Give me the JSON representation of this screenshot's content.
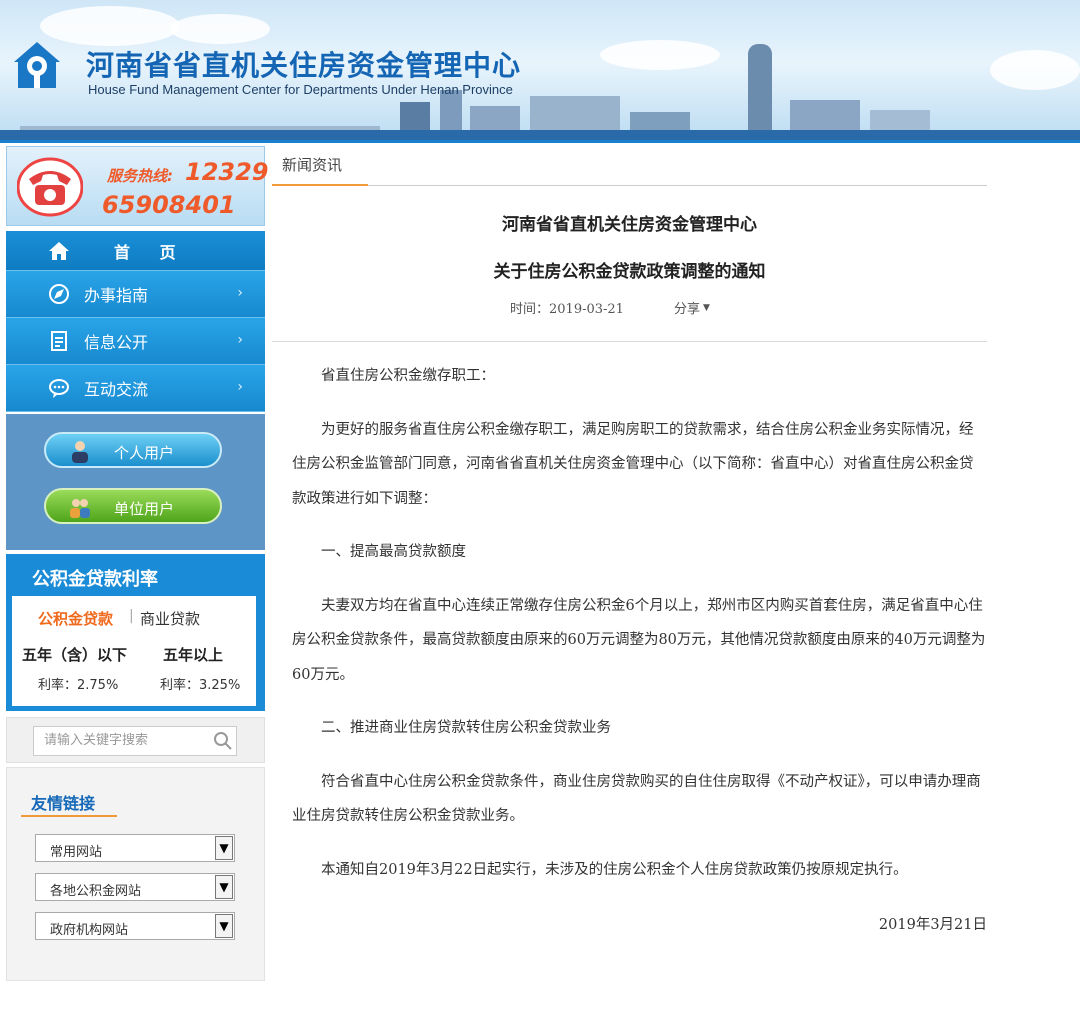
{
  "header": {
    "title": "河南省省直机关住房资金管理中心",
    "subtitle": "House Fund Management Center for Departments Under Henan Province"
  },
  "hotline": {
    "label": "服务热线:",
    "number1": "12329",
    "number2": "65908401"
  },
  "nav": {
    "items": [
      {
        "label": "首 页",
        "icon": "home-icon"
      },
      {
        "label": "办事指南",
        "icon": "compass-icon",
        "arrow": "›"
      },
      {
        "label": "信息公开",
        "icon": "document-icon",
        "arrow": "›"
      },
      {
        "label": "互动交流",
        "icon": "chat-icon",
        "arrow": "›"
      }
    ]
  },
  "users": {
    "personal": "个人用户",
    "company": "单位用户"
  },
  "rates": {
    "title": "公积金贷款利率",
    "tab_active": "公积金贷款",
    "separator": "|",
    "tab_inactive": "商业贷款",
    "col1_label": "五年（含）以下",
    "col2_label": "五年以上",
    "col1_rate": "利率：2.75%",
    "col2_rate": "利率：3.25%"
  },
  "search": {
    "placeholder": "请输入关键字搜索"
  },
  "links": {
    "title": "友情链接",
    "selects": [
      "常用网站",
      "各地公积金网站",
      "政府机构网站"
    ]
  },
  "main": {
    "breadcrumb": "新闻资讯",
    "title_line1": "河南省省直机关住房资金管理中心",
    "title_line2": "关于住房公积金贷款政策调整的通知",
    "time": "时间：2019-03-21",
    "share": "分享",
    "paragraphs": [
      "省直住房公积金缴存职工：",
      "为更好的服务省直住房公积金缴存职工，满足购房职工的贷款需求，结合住房公积金业务实际情况，经住房公积金监管部门同意，河南省省直机关住房资金管理中心（以下简称：省直中心）对省直住房公积金贷款政策进行如下调整：",
      "一、提高最高贷款额度",
      "夫妻双方均在省直中心连续正常缴存住房公积金6个月以上，郑州市区内购买首套住房，满足省直中心住房公积金贷款条件，最高贷款额度由原来的60万元调整为80万元，其他情况贷款额度由原来的40万元调整为60万元。",
      "二、推进商业住房贷款转住房公积金贷款业务",
      "符合省直中心住房公积金贷款条件，商业住房贷款购买的自住住房取得《不动产权证》，可以申请办理商业住房贷款转住房公积金贷款业务。",
      "本通知自2019年3月22日起实行，未涉及的住房公积金个人住房贷款政策仍按原规定执行。"
    ],
    "date_sign": "2019年3月21日"
  },
  "colors": {
    "brand_blue": "#1789cf",
    "accent_orange": "#f19a3a",
    "hotline_orange": "#ef5a2a"
  }
}
